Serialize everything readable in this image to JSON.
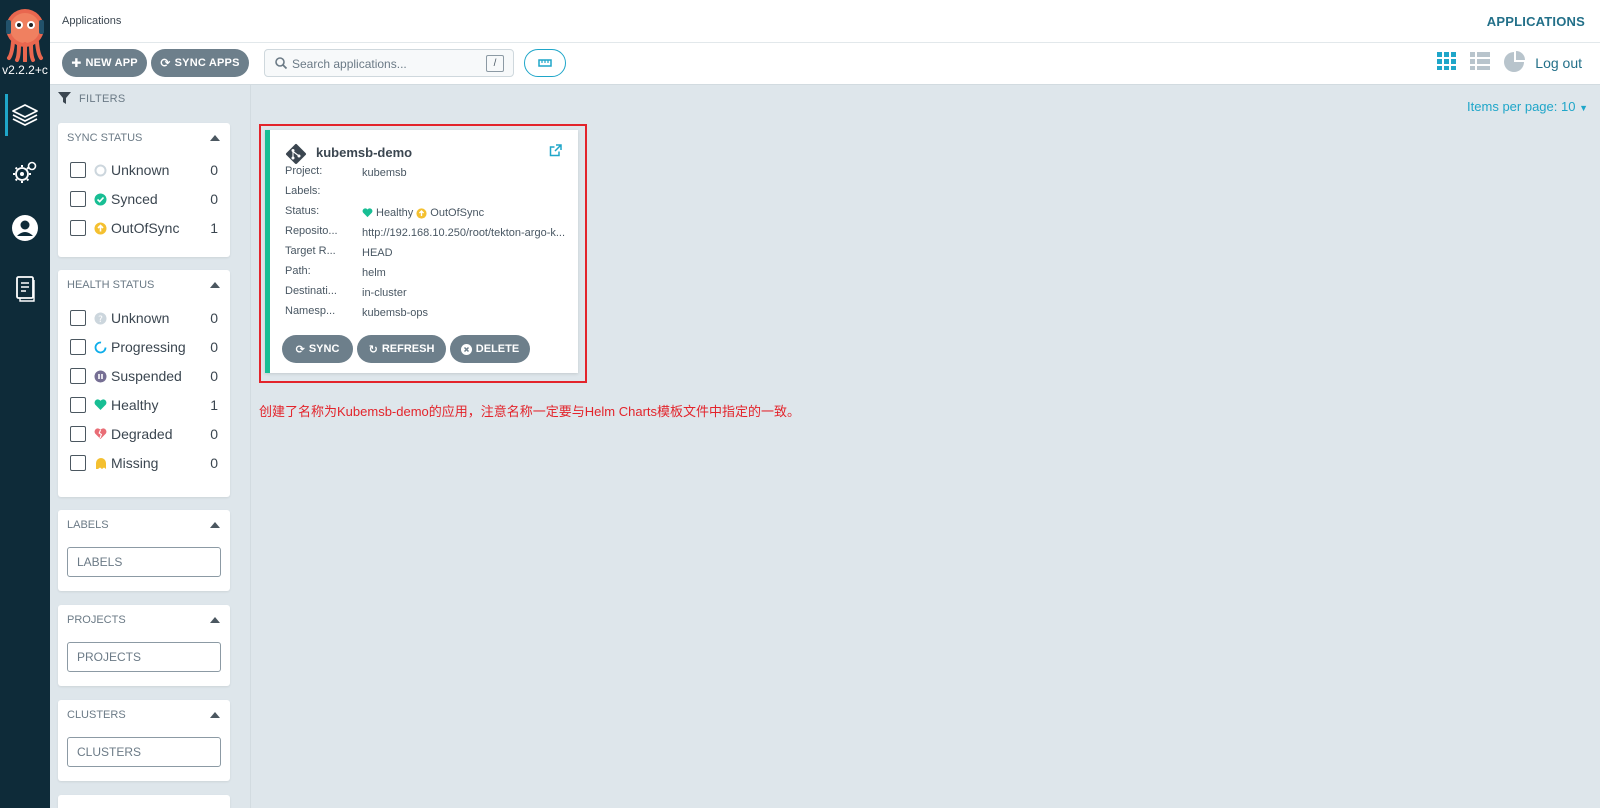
{
  "nav": {
    "version": "v2.2.2+c",
    "items": [
      {
        "name": "applications",
        "icon": "layers-icon",
        "active": true
      },
      {
        "name": "settings",
        "icon": "gears-icon",
        "active": false
      },
      {
        "name": "user-info",
        "icon": "user-circle-icon",
        "active": false
      },
      {
        "name": "docs",
        "icon": "docs-icon",
        "active": false
      }
    ]
  },
  "header": {
    "title": "Applications",
    "right_link": "APPLICATIONS"
  },
  "toolbar": {
    "new_app": "NEW APP",
    "sync_apps": "SYNC APPS",
    "search_placeholder": "Search applications...",
    "search_shortcut": "/",
    "logout": "Log out",
    "views": [
      "tiles-view-icon",
      "list-view-icon",
      "summary-view-icon"
    ]
  },
  "filters": {
    "heading": "FILTERS",
    "sync_status": {
      "title": "SYNC STATUS",
      "items": [
        {
          "label": "Unknown",
          "count": "0",
          "icon": "circle-notch-icon",
          "color": "#ccd6dd"
        },
        {
          "label": "Synced",
          "count": "0",
          "icon": "check-circle-icon",
          "color": "#18be94"
        },
        {
          "label": "OutOfSync",
          "count": "1",
          "icon": "arrow-circle-up-icon",
          "color": "#f4c030"
        }
      ]
    },
    "health_status": {
      "title": "HEALTH STATUS",
      "items": [
        {
          "label": "Unknown",
          "count": "0",
          "icon": "question-circle-icon",
          "color": "#ccd6dd"
        },
        {
          "label": "Progressing",
          "count": "0",
          "icon": "progress-circle-icon",
          "color": "#0dadea"
        },
        {
          "label": "Suspended",
          "count": "0",
          "icon": "pause-circle-icon",
          "color": "#766f94"
        },
        {
          "label": "Healthy",
          "count": "1",
          "icon": "heart-icon",
          "color": "#18be94"
        },
        {
          "label": "Degraded",
          "count": "0",
          "icon": "broken-heart-icon",
          "color": "#e96d76"
        },
        {
          "label": "Missing",
          "count": "0",
          "icon": "ghost-icon",
          "color": "#f4c030"
        }
      ]
    },
    "labels": {
      "title": "LABELS",
      "placeholder": "LABELS"
    },
    "projects": {
      "title": "PROJECTS",
      "placeholder": "PROJECTS"
    },
    "clusters": {
      "title": "CLUSTERS",
      "placeholder": "CLUSTERS"
    }
  },
  "content": {
    "items_per_page": "Items per page: 10",
    "apps": [
      {
        "name": "kubemsb-demo",
        "fields": [
          {
            "key": "Project:",
            "value": "kubemsb"
          },
          {
            "key": "Labels:",
            "value": ""
          },
          {
            "key": "Status:",
            "health": "Healthy",
            "sync": "OutOfSync"
          },
          {
            "key": "Reposito...",
            "value": "http://192.168.10.250/root/tekton-argo-k..."
          },
          {
            "key": "Target R...",
            "value": "HEAD"
          },
          {
            "key": "Path:",
            "value": "helm"
          },
          {
            "key": "Destinati...",
            "value": "in-cluster"
          },
          {
            "key": "Namesp...",
            "value": "kubemsb-ops"
          }
        ],
        "actions": [
          "SYNC",
          "REFRESH",
          "DELETE"
        ]
      }
    ],
    "annotation": "创建了名称为Kubemsb-demo的应用，注意名称一定要与Helm Charts模板文件中指定的一致。"
  },
  "colors": {
    "rail": "#0e2b39",
    "accent": "#1fa6c9",
    "button": "#6d7f8b",
    "healthy": "#18be94",
    "outofsync": "#f4c030",
    "highlight": "#e3242b"
  }
}
